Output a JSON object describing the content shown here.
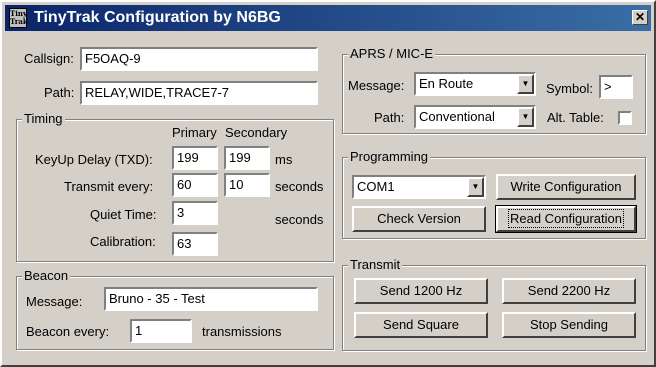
{
  "window": {
    "title": "TinyTrak Configuration by N6BG",
    "icon_text": "Tiny Trak",
    "close_glyph": "✕"
  },
  "top": {
    "callsign_label": "Callsign:",
    "callsign_value": "F5OAQ-9",
    "path_label": "Path:",
    "path_value": "RELAY,WIDE,TRACE7-7"
  },
  "timing": {
    "title": "Timing",
    "primary_header": "Primary",
    "secondary_header": "Secondary",
    "keyup_label": "KeyUp Delay (TXD):",
    "keyup_primary": "199",
    "keyup_secondary": "199",
    "keyup_unit": "ms",
    "transmit_label": "Transmit every:",
    "transmit_primary": "60",
    "transmit_secondary": "10",
    "transmit_unit": "seconds",
    "quiet_label": "Quiet Time:",
    "quiet_primary": "3",
    "quiet_unit": "seconds",
    "calibration_label": "Calibration:",
    "calibration_value": "63"
  },
  "beacon": {
    "title": "Beacon",
    "message_label": "Message:",
    "message_value": "Bruno - 35 - Test",
    "every_label": "Beacon every:",
    "every_value": "1",
    "every_unit": "transmissions"
  },
  "aprs": {
    "title": "APRS / MIC-E",
    "message_label": "Message:",
    "message_value": "En Route",
    "symbol_label": "Symbol:",
    "symbol_value": ">",
    "path_label": "Path:",
    "path_value": "Conventional",
    "alt_table_label": "Alt. Table:",
    "alt_table_checked": false
  },
  "programming": {
    "title": "Programming",
    "port_value": "COM1",
    "write_button": "Write Configuration",
    "check_button": "Check Version",
    "read_button": "Read Configuration"
  },
  "transmit": {
    "title": "Transmit",
    "send1200_button": "Send 1200 Hz",
    "send2200_button": "Send 2200 Hz",
    "square_button": "Send Square",
    "stop_button": "Stop Sending"
  }
}
